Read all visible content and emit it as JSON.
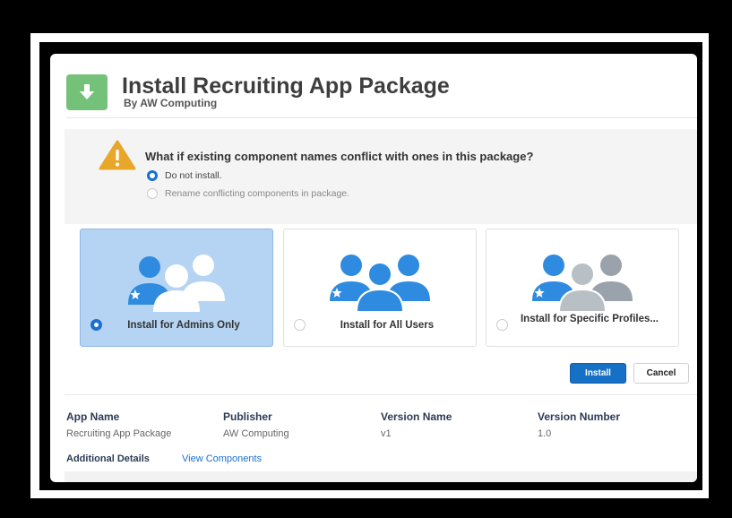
{
  "header": {
    "title": "Install Recruiting App Package",
    "publisher_line": "By AW Computing",
    "icon": "download-arrow-icon",
    "icon_color": "#74c27a"
  },
  "conflict": {
    "question": "What if existing component names conflict with ones in this package?",
    "options": [
      {
        "label": "Do not install.",
        "selected": true
      },
      {
        "label": "Rename conflicting components in package.",
        "selected": false
      }
    ]
  },
  "install_options": [
    {
      "label": "Install for Admins Only",
      "selected": true
    },
    {
      "label": "Install for All Users",
      "selected": false
    },
    {
      "label": "Install for Specific Profiles...",
      "selected": false
    }
  ],
  "buttons": {
    "install": "Install",
    "cancel": "Cancel"
  },
  "details": {
    "headers": [
      "App Name",
      "Publisher",
      "Version Name",
      "Version Number"
    ],
    "values": [
      "Recruiting App Package",
      "AW Computing",
      "v1",
      "1.0"
    ],
    "additional": "Additional Details",
    "view_components": "View Components"
  },
  "colors": {
    "accent": "#1670c6",
    "selected_tile": "#b5d3f2",
    "warning": "#e8a72a"
  }
}
